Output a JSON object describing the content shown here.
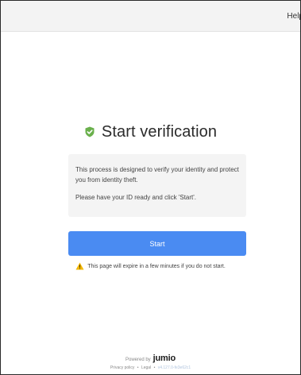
{
  "header": {
    "help_label": "Help"
  },
  "main": {
    "title": "Start verification",
    "title_icon": "check-shield-icon",
    "info_paragraph_1": "This process is designed to verify your identity and protect you from identity theft.",
    "info_paragraph_2": "Please have your ID ready and click 'Start'.",
    "start_button_label": "Start",
    "warning_text": "This page will expire in a few minutes if you do not start.",
    "warning_icon": "warning-triangle-icon"
  },
  "footer": {
    "powered_by": "Powered by",
    "brand": "jumio",
    "privacy_label": "Privacy policy",
    "separator": "•",
    "legal_label": "Legal",
    "version": "v4.127.0-fe3e62c1"
  },
  "colors": {
    "accent": "#4a8bf2",
    "check": "#6ab04c",
    "warning": "#f2b705",
    "topbar": "#f3f3f3",
    "info_box": "#f4f4f4"
  }
}
